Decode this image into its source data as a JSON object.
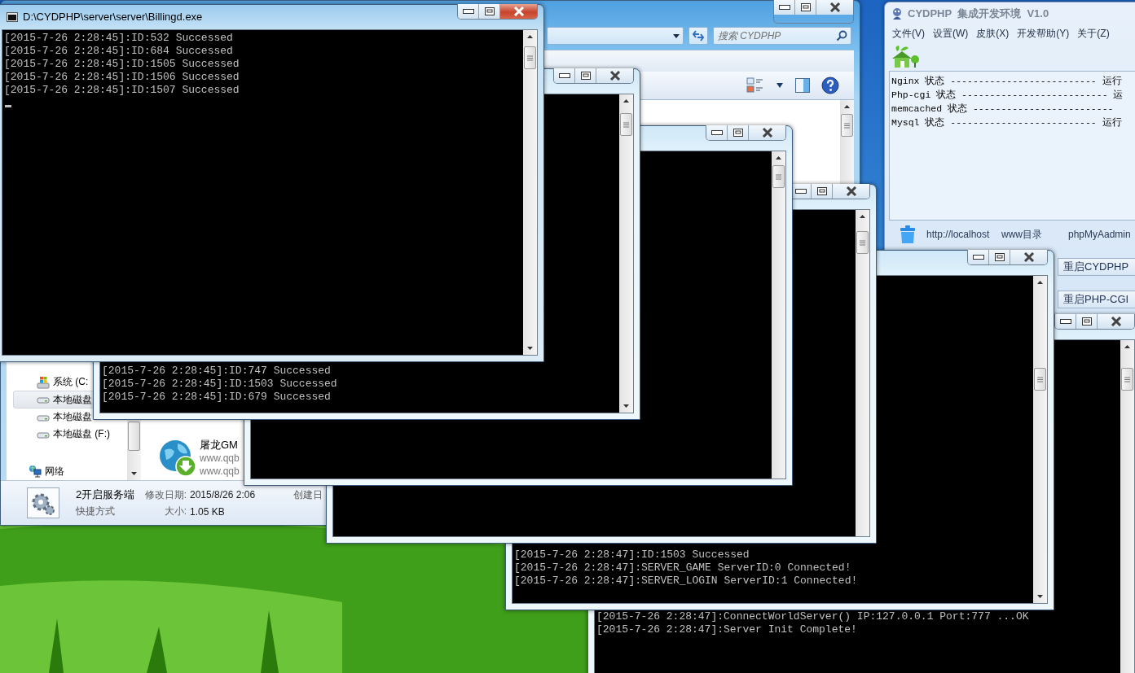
{
  "consoles": [
    {
      "title": "D:\\CYDPHP\\server\\server\\Billingd.exe",
      "active": true,
      "cursor": true,
      "lines": [
        "[2015-7-26 2:28:45]:ID:532 Successed",
        "[2015-7-26 2:28:45]:ID:684 Successed",
        "[2015-7-26 2:28:45]:ID:1505 Successed",
        "[2015-7-26 2:28:45]:ID:1506 Successed",
        "[2015-7-26 2:28:45]:ID:1507 Successed"
      ]
    },
    {
      "active": false,
      "lines": [
        "[2015-7-26 2:28:45]:ID:747 Successed",
        "[2015-7-26 2:28:45]:ID:1503 Successed",
        "[2015-7-26 2:28:45]:ID:679 Successed"
      ]
    },
    {
      "active": false
    },
    {
      "active": false
    },
    {
      "active": false,
      "lines": [
        "[2015-7-26 2:28:47]:ID:1503 Successed",
        "[2015-7-26 2:28:47]:SERVER_GAME ServerID:0 Connected!",
        "[2015-7-26 2:28:47]:SERVER_LOGIN ServerID:1 Connected!"
      ]
    },
    {
      "active": false,
      "lines": [
        "[2015-7-26 2:28:47]:ConnectWorldServer() IP:127.0.0.1 Port:777 ...OK",
        "[2015-7-26 2:28:47]:Server Init Complete!"
      ]
    }
  ],
  "explorer": {
    "search": {
      "placeholder": "搜索 CYDPHP"
    },
    "nav_items": [
      {
        "kind": "system",
        "label": "系统 (C:",
        "selected": false
      },
      {
        "kind": "disk",
        "label": "本地磁盘",
        "selected": true
      },
      {
        "kind": "disk",
        "label": "本地磁盘",
        "selected": false
      },
      {
        "kind": "disk",
        "label": "本地磁盘 (F:)",
        "selected": false
      },
      {
        "kind": "network",
        "label": "网络",
        "selected": false
      }
    ],
    "files": [
      {
        "name": "屠龙GM",
        "lines": [
          "www.qqb",
          "www.qqb"
        ]
      }
    ],
    "details": {
      "name": "2开启服务端",
      "type": "快捷方式",
      "fields": [
        {
          "label": "修改日期:",
          "value": "2015/8/26 2:06"
        },
        {
          "label": "大小:",
          "value": "1.05 KB"
        }
      ],
      "extra_label": "创建日"
    }
  },
  "cydphp": {
    "title": "CYDPHP  集成开发环境  V1.0",
    "menu": [
      "文件(V)",
      "设置(W)",
      "皮肤(X)",
      "开发帮助(Y)",
      "关于(Z)"
    ],
    "status_lines": [
      "Nginx 状态 -------------------------- 运行",
      "Php-cgi 状态 -------------------------- 运",
      "memcached 状态 -------------------------",
      "Mysql 状态 -------------------------- 运行"
    ],
    "links": [
      "http://localhost",
      "www目录",
      "phpMyAadmin"
    ],
    "buttons": [
      "重启CYDPHP",
      "重启PHP-CGI"
    ]
  }
}
